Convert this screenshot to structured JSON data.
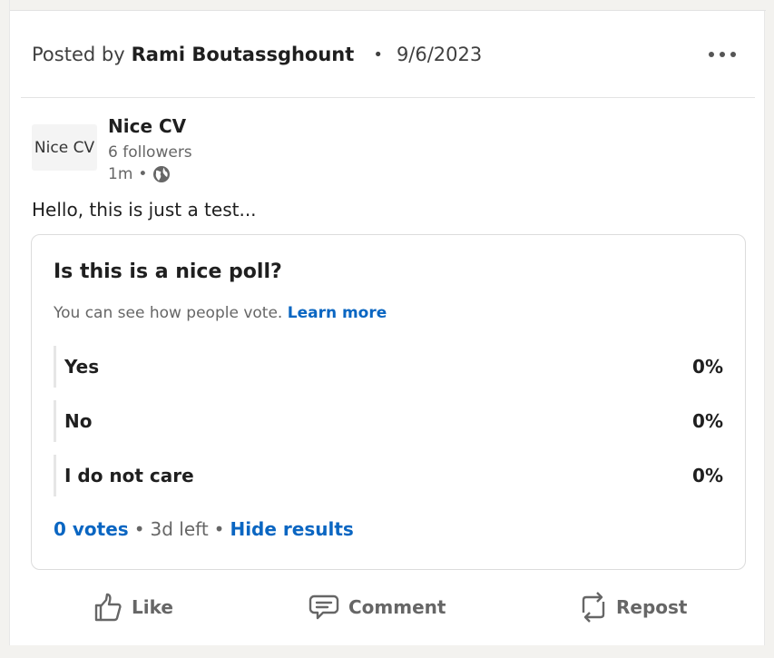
{
  "post": {
    "posted_by_prefix": "Posted by",
    "author": "Rami Boutassghount",
    "bullet": "•",
    "date": "9/6/2023"
  },
  "company": {
    "logo_text": "Nice CV",
    "name": "Nice CV",
    "followers": "6 followers",
    "time": "1m",
    "bullet": "•",
    "visibility_icon": "globe-icon"
  },
  "body_text": "Hello, this is just a test...",
  "poll": {
    "question": "Is this is a nice poll?",
    "note": "You can see how people vote.",
    "learn_more": "Learn more",
    "options": [
      {
        "label": "Yes",
        "percent": "0%"
      },
      {
        "label": "No",
        "percent": "0%"
      },
      {
        "label": "I do not care",
        "percent": "0%"
      }
    ],
    "votes": "0 votes",
    "bullet": "•",
    "time_left": "3d left",
    "hide_results": "Hide results"
  },
  "actions": {
    "like": "Like",
    "comment": "Comment",
    "repost": "Repost"
  },
  "colors": {
    "link": "#0a66c2",
    "muted_text": "#666666",
    "border": "#dcdcdc"
  }
}
